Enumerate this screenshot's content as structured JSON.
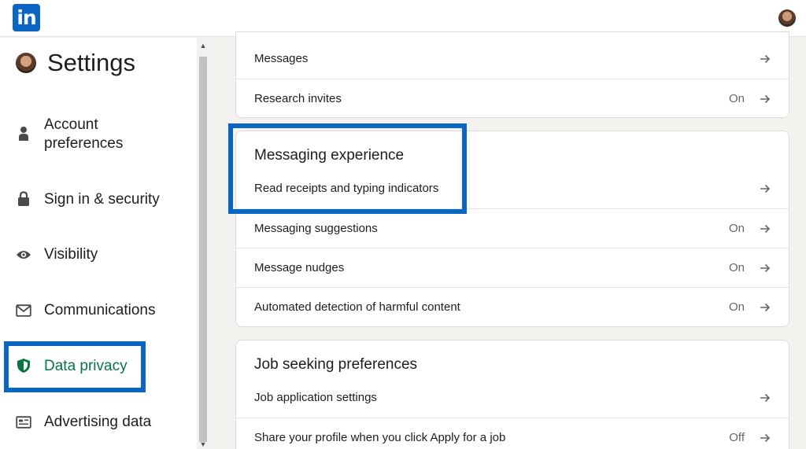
{
  "topbar": {
    "logo_text": "in"
  },
  "sidebar": {
    "title": "Settings",
    "items": [
      {
        "label": "Account\npreferences",
        "icon": "person-icon",
        "active": false
      },
      {
        "label": "Sign in & security",
        "icon": "lock-icon",
        "active": false
      },
      {
        "label": "Visibility",
        "icon": "eye-icon",
        "active": false
      },
      {
        "label": "Communications",
        "icon": "envelope-icon",
        "active": false
      },
      {
        "label": "Data privacy",
        "icon": "shield-icon",
        "active": true
      },
      {
        "label": "Advertising data",
        "icon": "ad-card-icon",
        "active": false
      }
    ]
  },
  "main": {
    "card1": {
      "rows": [
        {
          "label": "Messages",
          "status": ""
        },
        {
          "label": "Research invites",
          "status": "On"
        }
      ]
    },
    "card2": {
      "title": "Messaging experience",
      "rows": [
        {
          "label": "Read receipts and typing indicators",
          "status": ""
        },
        {
          "label": "Messaging suggestions",
          "status": "On"
        },
        {
          "label": "Message nudges",
          "status": "On"
        },
        {
          "label": "Automated detection of harmful content",
          "status": "On"
        }
      ]
    },
    "card3": {
      "title": "Job seeking preferences",
      "rows": [
        {
          "label": "Job application settings",
          "status": ""
        },
        {
          "label": "Share your profile when you click Apply for a job",
          "status": "Off"
        }
      ]
    }
  },
  "colors": {
    "brand": "#0a66c2",
    "active_green": "#057642",
    "highlight_box": "#0a66c2"
  }
}
